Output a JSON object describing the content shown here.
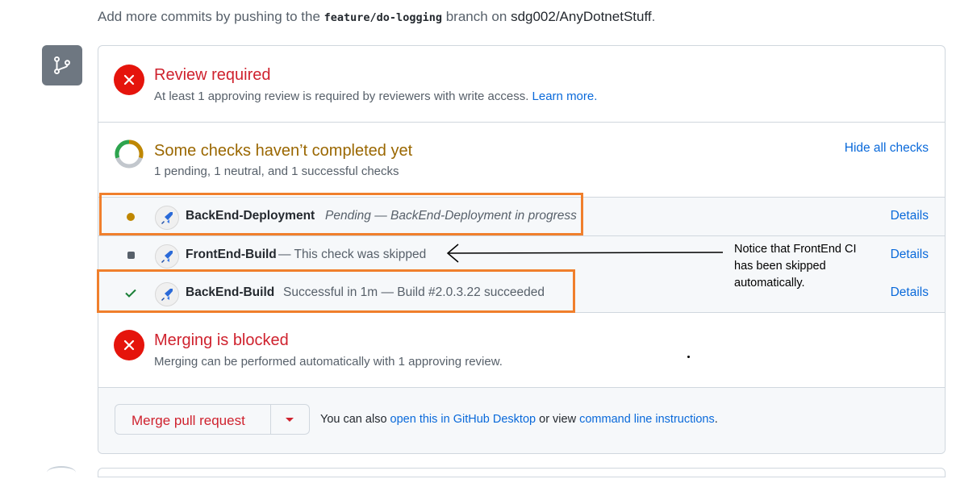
{
  "header": {
    "prefix": "Add more commits by pushing to the",
    "branch": "feature/do-logging",
    "middle": "branch on",
    "repo": "sdg002/AnyDotnetStuff",
    "suffix": "."
  },
  "review": {
    "title": "Review required",
    "text": "At least 1 approving review is required by reviewers with write access.",
    "link": "Learn more."
  },
  "checks": {
    "title": "Some checks haven’t completed yet",
    "summary": "1 pending, 1 neutral, and 1 successful checks",
    "hide_link": "Hide all checks",
    "items": [
      {
        "name": "BackEnd-Deployment",
        "description": "Pending — BackEnd-Deployment in progress",
        "status": "pending",
        "details": "Details"
      },
      {
        "name": "FrontEnd-Build",
        "description": "— This check was skipped",
        "status": "skipped",
        "details": "Details"
      },
      {
        "name": "BackEnd-Build",
        "description": "Successful in 1m — Build #2.0.3.22 succeeded",
        "status": "success",
        "details": "Details"
      }
    ]
  },
  "merge": {
    "title": "Merging is blocked",
    "text": "Merging can be performed automatically with 1 approving review."
  },
  "footer": {
    "button_label": "Merge pull request",
    "also_prefix": "You can also",
    "desktop_link": "open this in GitHub Desktop",
    "or_view": "or view",
    "cli_link": "command line instructions",
    "suffix": "."
  },
  "annotation": {
    "text": "Notice that FrontEnd CI has been skipped automatically."
  },
  "colors": {
    "error": "#cf222e",
    "pending": "#bf8700",
    "success": "#1a7f37",
    "link": "#0969da",
    "highlight": "#f07f2c"
  },
  "icons": {
    "branch": "git-branch-icon",
    "review": "x-circle-icon",
    "checks": "progress-ring-icon",
    "app": "azure-pipelines-icon"
  }
}
